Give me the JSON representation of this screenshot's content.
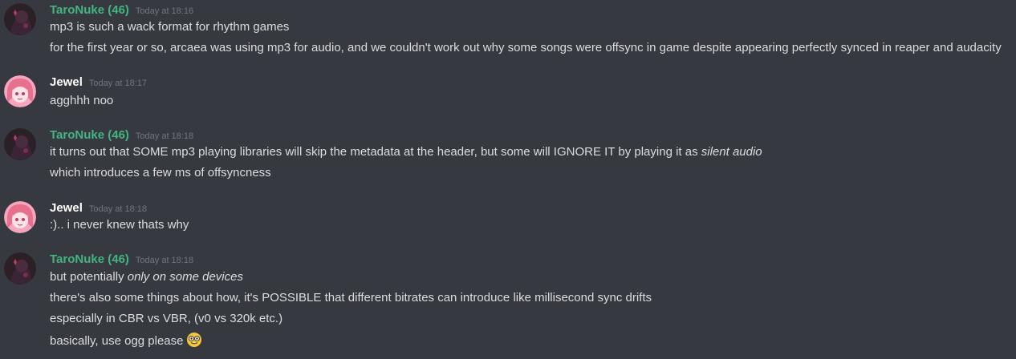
{
  "users": {
    "taro": {
      "name": "TaroNuke (46)",
      "color": "#43b581"
    },
    "jewel": {
      "name": "Jewel",
      "color": "#ffffff"
    }
  },
  "messages": [
    {
      "author": "TaroNuke (46)",
      "timestamp": "Today at 18:16",
      "lines": [
        "mp3 is such a wack format for rhythm games",
        "for the first year or so, arcaea was using mp3 for audio, and we couldn't work out why some songs were offsync in game despite appearing perfectly synced in reaper and audacity"
      ]
    },
    {
      "author": "Jewel",
      "timestamp": "Today at 18:17",
      "lines": [
        "agghhh noo"
      ]
    },
    {
      "author": "TaroNuke (46)",
      "timestamp": "Today at 18:18",
      "lines": [
        "it turns out that SOME mp3 playing libraries will skip the metadata at the header, but some will IGNORE IT by playing it as ",
        "silent audio",
        "which introduces a few ms of offsyncness"
      ]
    },
    {
      "author": "Jewel",
      "timestamp": "Today at 18:18",
      "lines": [
        ":).. i never knew thats why"
      ]
    },
    {
      "author": "TaroNuke (46)",
      "timestamp": "Today at 18:18",
      "lines": [
        "but potentially ",
        "only on some devices",
        "there's also some things about how, it's POSSIBLE that different bitrates can introduce like millisecond sync drifts",
        "especially in CBR vs VBR, (v0 vs 320k etc.)",
        "basically, use ogg please"
      ]
    }
  ],
  "icons": {
    "avatar_taro": "avatar-taronuke",
    "avatar_jewel": "avatar-jewel",
    "emoji": "nerd-face-emoji"
  }
}
